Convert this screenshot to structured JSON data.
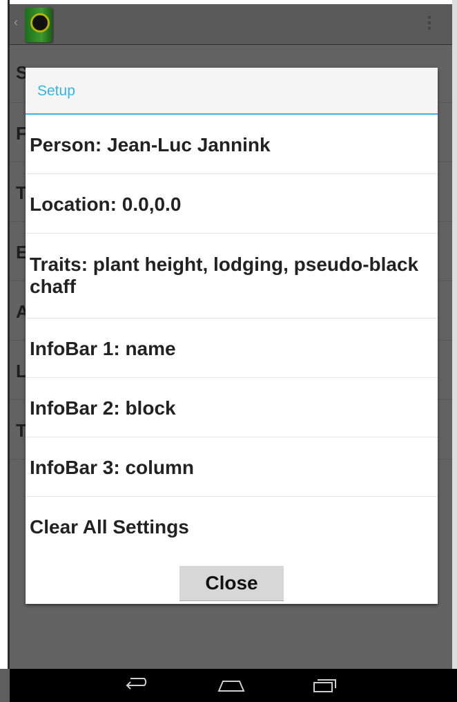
{
  "dialog": {
    "title": "Setup",
    "items": [
      {
        "label": "Person: Jean-Luc Jannink"
      },
      {
        "label": "Location: 0.0,0.0"
      },
      {
        "label": "Traits: plant height, lodging, pseudo-black chaff"
      },
      {
        "label": "InfoBar 1: name"
      },
      {
        "label": "InfoBar 2: block"
      },
      {
        "label": "InfoBar 3: column"
      },
      {
        "label": "Clear All Settings"
      }
    ],
    "close_label": "Close"
  },
  "background": {
    "row_initials": [
      "S",
      "F",
      "T",
      "E",
      "A",
      "L",
      "T"
    ]
  },
  "icons": {
    "app": "app-icon",
    "overflow": "overflow-menu-icon",
    "back": "back-icon",
    "home": "home-icon",
    "recents": "recents-icon"
  },
  "colors": {
    "accent": "#33b5e5",
    "scrim": "#636363",
    "nav_bar": "#000000"
  }
}
